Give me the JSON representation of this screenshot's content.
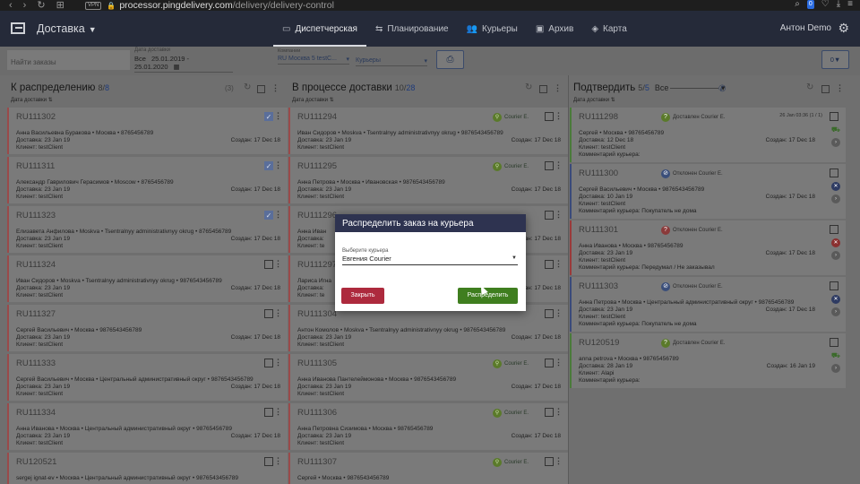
{
  "browser": {
    "nav": [
      "‹",
      "›",
      "↻",
      "⊞"
    ],
    "vpn": "VPN",
    "url_host": "processor.pingdelivery.com",
    "url_path": "/delivery/delivery-control",
    "badge": "0"
  },
  "app": {
    "brand": "Доставка",
    "tabs": [
      {
        "label": "Диспетчерская",
        "icon": "monitor-icon",
        "glyph": "▭",
        "active": true
      },
      {
        "label": "Планирование",
        "icon": "swap-icon",
        "glyph": "⇆",
        "active": false
      },
      {
        "label": "Курьеры",
        "icon": "people-icon",
        "glyph": "👥",
        "active": false
      },
      {
        "label": "Архив",
        "icon": "archive-icon",
        "glyph": "▣",
        "active": false
      },
      {
        "label": "Карта",
        "icon": "layers-icon",
        "glyph": "◈",
        "active": false
      }
    ],
    "user": "Антон Demo"
  },
  "filters": {
    "search_placeholder": "Найти заказы",
    "date_label": "Дата доставки",
    "date_prefix": "Все",
    "date_value": "25.01.2019 - 25.01.2020",
    "companies_label": "Компании",
    "companies_value": "RU Москва 5 testC...",
    "couriers_value": "Курьеры",
    "filter_count": "0"
  },
  "columns": [
    {
      "title": "К распределению",
      "count": "8",
      "total": "8",
      "paren": "(3)",
      "sort_label": "Дата доставки",
      "cards": [
        {
          "prefix": "RU",
          "id": "111302",
          "line1": "Анна Васильевна Буракова • Москва • 8765456789",
          "delivery": "Доставка: 23 Jan 19",
          "client": "Клиент: testClient",
          "created": "Создан: 17 Dec 18",
          "checked": true
        },
        {
          "prefix": "RU",
          "id": "111311",
          "line1": "Александр Гаврилович Герасимов • Moscow • 8765456789",
          "delivery": "Доставка: 23 Jan 19",
          "client": "Клиент: testClient",
          "created": "Создан: 17 Dec 18",
          "checked": true
        },
        {
          "prefix": "RU",
          "id": "111323",
          "line1": "Елизавета Анфилова • Moskva • Tsentralnyy administrativnyy okrug • 8765456789",
          "delivery": "Доставка: 23 Jan 19",
          "client": "Клиент: testClient",
          "created": "Создан: 17 Dec 18",
          "checked": true
        },
        {
          "prefix": "RU",
          "id": "111324",
          "line1": "Иван Сидоров • Moskva • Tsentralnyy administrativnyy okrug • 9876543456789",
          "delivery": "Доставка: 23 Jan 19",
          "client": "Клиент: testClient",
          "created": "Создан: 17 Dec 18",
          "checked": false
        },
        {
          "prefix": "RU",
          "id": "111327",
          "line1": "Сергей Васильевич • Москва • 9876543456789",
          "delivery": "Доставка: 23 Jan 19",
          "client": "Клиент: testClient",
          "created": "Создан: 17 Dec 18",
          "checked": false
        },
        {
          "prefix": "RU",
          "id": "111333",
          "line1": "Сергей Васильевич • Москва • Центральный административный округ • 9876543456789",
          "delivery": "Доставка: 23 Jan 19",
          "client": "Клиент: testClient",
          "created": "Создан: 17 Dec 18",
          "checked": false
        },
        {
          "prefix": "RU",
          "id": "111334",
          "line1": "Анна Иванова • Москва • Центральный административный округ • 98765456789",
          "delivery": "Доставка: 23 Jan 19",
          "client": "Клиент: testClient",
          "created": "Создан: 17 Dec 18",
          "checked": false
        },
        {
          "prefix": "RU",
          "id": "120521",
          "line1": "sergej ignat-ev • Москва • Центральный административный округ • 9876543456789",
          "delivery": "",
          "client": "",
          "created": "",
          "checked": false
        }
      ]
    },
    {
      "title": "В процессе доставки",
      "count": "10",
      "total": "28",
      "sort_label": "Дата доставки",
      "cards": [
        {
          "prefix": "RU",
          "id": "111294",
          "courier": "Courier E.",
          "line1": "Иван Сидоров • Moskva • Tsentralnyy administrativnyy okrug • 9876543456789",
          "delivery": "Доставка: 23 Jan 19",
          "client": "Клиент: testClient",
          "created": "Создан: 17 Dec 18"
        },
        {
          "prefix": "RU",
          "id": "111295",
          "courier": "Courier E.",
          "line1": "Анна Петрова • Москва • Ивановская • 9876543456789",
          "delivery": "Доставка: 23 Jan 19",
          "client": "Клиент: testClient",
          "created": "Создан: 17 Dec 18"
        },
        {
          "prefix": "RU",
          "id": "111296",
          "courier": "",
          "line1": "Анна Иван",
          "delivery": "Доставка:",
          "client": "Клиент: te",
          "created": "Создан: 17 Dec 18"
        },
        {
          "prefix": "RU",
          "id": "111297",
          "courier": "",
          "line1": "Лариса Игна",
          "delivery": "Доставка:",
          "client": "Клиент: te",
          "created": "Создан: 17 Dec 18"
        },
        {
          "prefix": "RU",
          "id": "111304",
          "courier": "",
          "line1": "Антон Комолов • Moskva • Tsentralnyy administrativnyy okrug • 9876543456789",
          "delivery": "Доставка: 23 Jan 19",
          "client": "Клиент: testClient",
          "created": "Создан: 17 Dec 18"
        },
        {
          "prefix": "RU",
          "id": "111305",
          "courier": "Courier E.",
          "line1": "Анна Иванова Пантелеймонова • Москва • 9876543456789",
          "delivery": "Доставка: 23 Jan 19",
          "client": "Клиент: testClient",
          "created": "Создан: 17 Dec 18"
        },
        {
          "prefix": "RU",
          "id": "111306",
          "courier": "Courier E.",
          "line1": "Анна Петровна Сизимова • Москва • 98765456789",
          "delivery": "Доставка: 23 Jan 19",
          "client": "Клиент: testClient",
          "created": "Создан: 17 Dec 18"
        },
        {
          "prefix": "RU",
          "id": "111307",
          "courier": "Courier E.",
          "line1": "Сергей • Москва • 9876543456789",
          "delivery": "",
          "client": "",
          "created": ""
        }
      ]
    },
    {
      "title": "Подтвердить",
      "count": "5",
      "total": "5",
      "dropdown": "Все",
      "sort_label": "Дата доставки",
      "cards": [
        {
          "prefix": "RU",
          "id": "111298",
          "status": "Доставлен Courier E.",
          "status_kind": "ok",
          "meta": "26 Jan 03:36   (1 / 1)",
          "line1": "Сергей • Москва • 98765456789",
          "delivery": "Доставка: 12 Dec 18",
          "client": "Клиент: testClient",
          "comment": "Комментарий курьера:",
          "created": "Создан: 17 Dec 18",
          "color": "green"
        },
        {
          "prefix": "RU",
          "id": "111300",
          "status": "Отклонен Courier E.",
          "status_kind": "rej",
          "meta": "",
          "line1": "Сергей Васильевич • Москва • 9876543456789",
          "delivery": "Доставка: 10 Jan 19",
          "client": "Клиент: testClient",
          "comment": "Комментарий курьера: Покупатель не дома",
          "created": "Создан: 17 Dec 18",
          "color": "blue"
        },
        {
          "prefix": "RU",
          "id": "111301",
          "status": "Отклонен Courier E.",
          "status_kind": "q",
          "meta": "",
          "line1": "Анна Иванова • Москва • 98765456789",
          "delivery": "Доставка: 23 Jan 19",
          "client": "Клиент: testClient",
          "comment": "Комментарий курьера: Передумал / Не заказывал",
          "created": "Создан: 17 Dec 18",
          "color": "red"
        },
        {
          "prefix": "RU",
          "id": "111303",
          "status": "Отклонен Courier E.",
          "status_kind": "rej",
          "meta": "",
          "line1": "Анна Петрова • Москва • Центральный административный округ • 98765456789",
          "delivery": "Доставка: 23 Jan 19",
          "client": "Клиент: testClient",
          "comment": "Комментарий курьера: Покупатель не дома",
          "created": "Создан: 17 Dec 18",
          "color": "blue"
        },
        {
          "prefix": "RU",
          "id": "120519",
          "status": "Доставлен Courier E.",
          "status_kind": "ok",
          "meta": "",
          "line1": "anna petrova • Москва • 98765456789",
          "delivery": "Доставка: 28 Jan 19",
          "client": "Клиент: Alapi",
          "comment": "Комментарий курьера:",
          "created": "Создан: 16 Jan 19",
          "color": "green"
        }
      ]
    }
  ],
  "modal": {
    "title": "Распределить заказ на курьера",
    "field_label": "Выберите курьера",
    "field_value": "Евгения Courier",
    "close_label": "Закрыть",
    "assign_label": "Распределить"
  }
}
